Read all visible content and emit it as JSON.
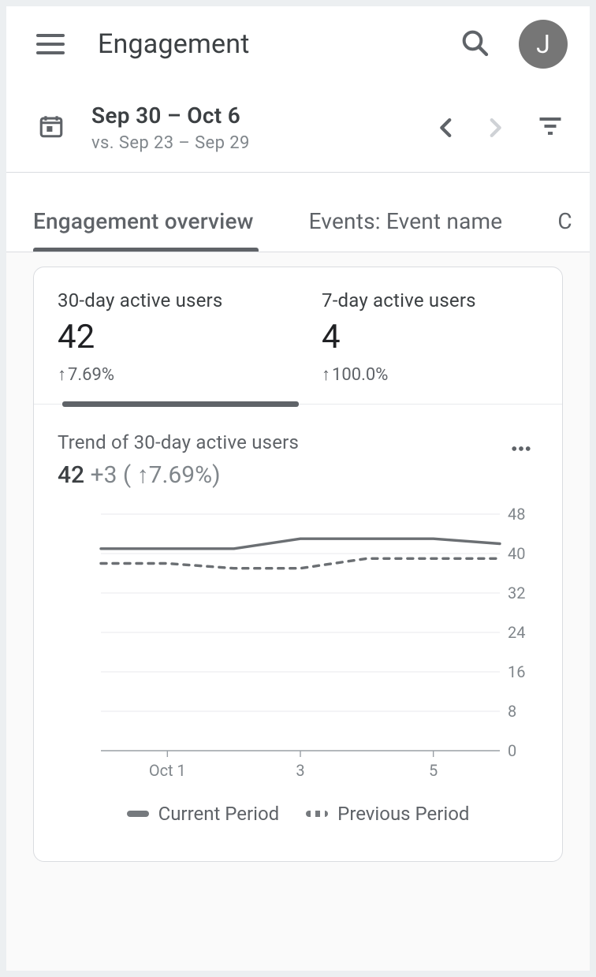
{
  "header": {
    "title": "Engagement",
    "avatar_initial": "J"
  },
  "date_range": {
    "primary": "Sep 30 – Oct 6",
    "comparison_prefix": "vs. ",
    "comparison": "Sep 23 – Sep 29"
  },
  "tabs": [
    {
      "label": "Engagement overview",
      "active": true
    },
    {
      "label": "Events: Event name",
      "active": false
    },
    {
      "label": "C",
      "active": false
    }
  ],
  "metrics": [
    {
      "title": "30-day active users",
      "value": "42",
      "delta": "7.69%",
      "direction": "up",
      "active": true
    },
    {
      "title": "7-day active users",
      "value": "4",
      "delta": "100.0%",
      "direction": "up",
      "active": false
    }
  ],
  "trend": {
    "title": "Trend of 30-day active users",
    "value": "42",
    "change_abs": "+3",
    "change_pct": "7.69%",
    "direction": "up"
  },
  "legend": {
    "current": "Current Period",
    "previous": "Previous Period"
  },
  "chart_data": {
    "type": "line",
    "xlabel": "",
    "ylabel": "",
    "ylim": [
      0,
      48
    ],
    "y_ticks": [
      0,
      8,
      16,
      24,
      32,
      40,
      48
    ],
    "x_ticks": [
      "Oct 1",
      "3",
      "5"
    ],
    "categories": [
      "Sep 30",
      "Oct 1",
      "Oct 2",
      "Oct 3",
      "Oct 4",
      "Oct 5",
      "Oct 6"
    ],
    "series": [
      {
        "name": "Current Period",
        "style": "solid",
        "values": [
          41,
          41,
          41,
          43,
          43,
          43,
          42
        ]
      },
      {
        "name": "Previous Period",
        "style": "dashed",
        "values": [
          38,
          38,
          37,
          37,
          39,
          39,
          39
        ]
      }
    ]
  }
}
